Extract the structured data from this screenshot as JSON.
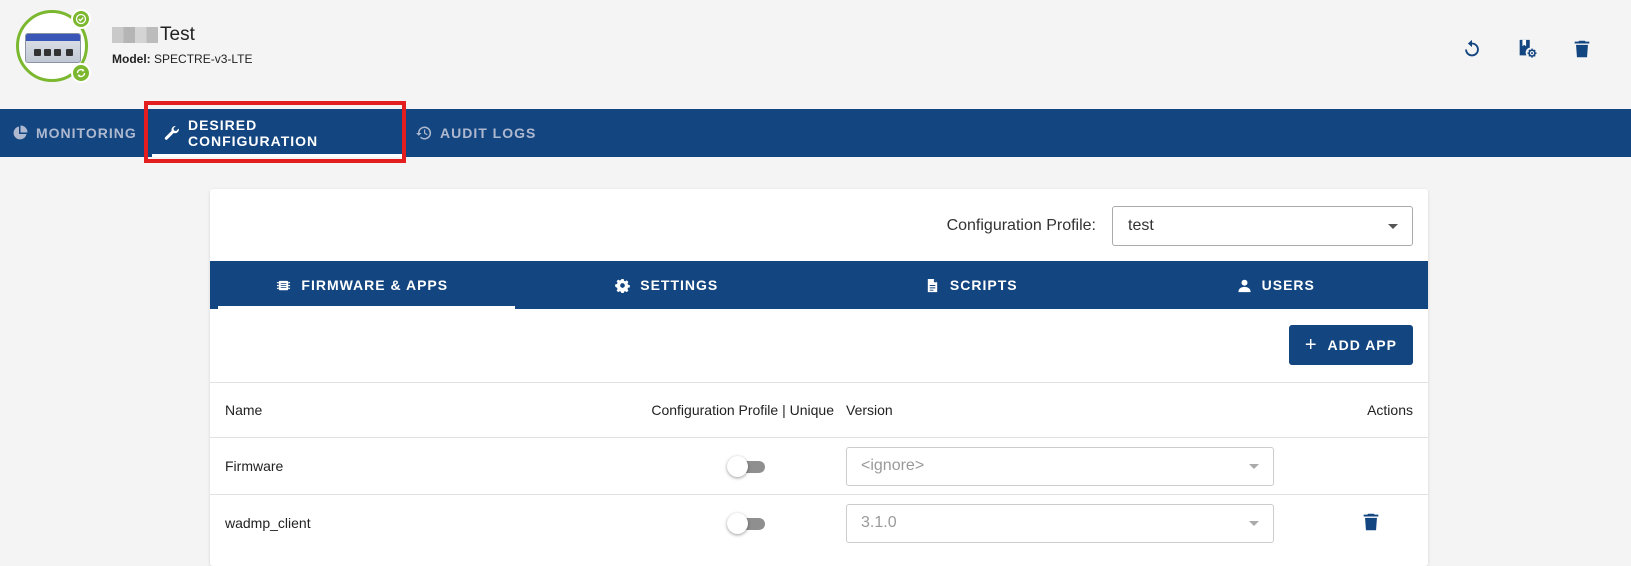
{
  "header": {
    "device_name": "Test",
    "model_label": "Model:",
    "model_value": "SPECTRE-v3-LTE",
    "actions": [
      "reload-icon",
      "profile-settings-icon",
      "trash-icon"
    ]
  },
  "main_nav": {
    "tabs": [
      {
        "label": "MONITORING",
        "icon": "pie-chart-icon"
      },
      {
        "label": "DESIRED CONFIGURATION",
        "icon": "wrench-icon",
        "active": true
      },
      {
        "label": "AUDIT LOGS",
        "icon": "history-icon"
      }
    ]
  },
  "config": {
    "profile_label": "Configuration Profile:",
    "profile_value": "test"
  },
  "sub_nav": {
    "tabs": [
      {
        "label": "FIRMWARE & APPS",
        "icon": "chip-icon",
        "active": true
      },
      {
        "label": "SETTINGS",
        "icon": "gear-icon"
      },
      {
        "label": "SCRIPTS",
        "icon": "document-icon"
      },
      {
        "label": "USERS",
        "icon": "user-icon"
      }
    ]
  },
  "toolbar": {
    "add_app_label": "ADD APP"
  },
  "table": {
    "columns": [
      "Name",
      "Configuration Profile | Unique",
      "Version",
      "Actions"
    ],
    "rows": [
      {
        "name": "Firmware",
        "unique": false,
        "version": "<ignore>",
        "deletable": false
      },
      {
        "name": "wadmp_client",
        "unique": false,
        "version": "3.1.0",
        "deletable": true
      }
    ]
  },
  "colors": {
    "brand_blue": "#134580",
    "status_green": "#7cb82f",
    "highlight_red": "#e41e1e"
  }
}
